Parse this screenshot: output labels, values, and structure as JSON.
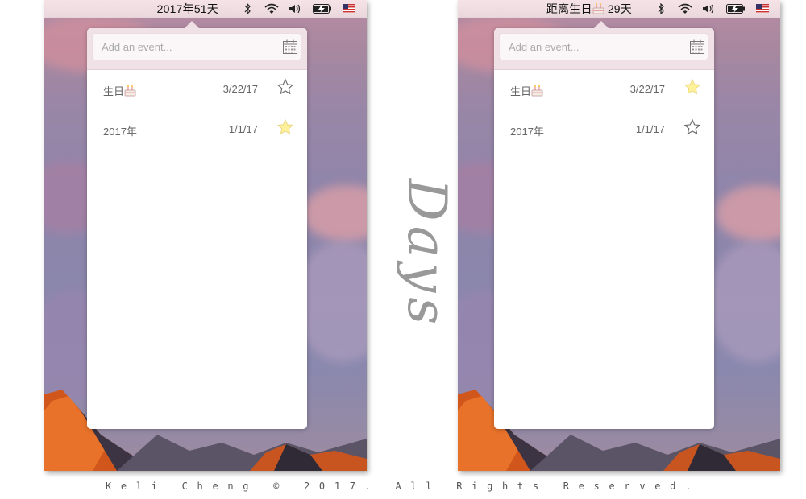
{
  "screenshots": [
    {
      "menubar": {
        "title": "2017年51天"
      },
      "input": {
        "placeholder": "Add an event..."
      },
      "events": [
        {
          "name": "生日",
          "emoji": "cake",
          "date": "3/22/17",
          "starred": false
        },
        {
          "name": "2017年",
          "emoji": "",
          "date": "1/1/17",
          "starred": true
        }
      ]
    },
    {
      "menubar": {
        "title_prefix": "距离生日",
        "title_suffix": " 29天"
      },
      "input": {
        "placeholder": "Add an event..."
      },
      "events": [
        {
          "name": "生日",
          "emoji": "cake",
          "date": "3/22/17",
          "starred": true
        },
        {
          "name": "2017年",
          "emoji": "",
          "date": "1/1/17",
          "starred": false
        }
      ]
    }
  ],
  "menubar_icons": [
    "bluetooth-icon",
    "wifi-icon",
    "volume-icon",
    "battery-charging-icon",
    "us-flag-icon"
  ],
  "logo": {
    "text": "Days"
  },
  "footer": {
    "text": "Keli Cheng © 2017. All Rights Reserved."
  },
  "colors": {
    "star_filled": "#fff09a",
    "star_outline": "#666666"
  }
}
